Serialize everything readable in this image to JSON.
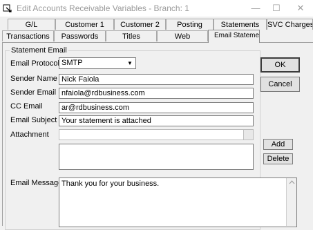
{
  "window": {
    "title": "Edit Accounts Receivable Variables  - Branch: 1",
    "minimize": "—",
    "maximize": "☐",
    "close": "✕"
  },
  "tabs_back": [
    "G/L",
    "Customer 1",
    "Customer 2",
    "Posting",
    "Statements",
    "SVC Charges"
  ],
  "tabs_front": [
    "Transactions",
    "Passwords",
    "Titles",
    "Web",
    "Email Statement"
  ],
  "form": {
    "group_title": "Statement Email",
    "protocol_label": "Email Protocol",
    "protocol_value": "SMTP",
    "sender_name_label": "Sender Name",
    "sender_name_value": "Nick Faiola",
    "sender_email_label": "Sender Email",
    "sender_email_value": "nfaiola@rdbusiness.com",
    "cc_email_label": "CC Email",
    "cc_email_value": "ar@rdbusiness.com",
    "subject_label": "Email Subject",
    "subject_value": "Your statement is attached",
    "attachment_label": "Attachment",
    "attachment_value": "",
    "message_label": "Email Message",
    "message_value": "Thank you for your business."
  },
  "buttons": {
    "ok": "OK",
    "cancel": "Cancel",
    "add": "Add",
    "delete": "Delete"
  }
}
